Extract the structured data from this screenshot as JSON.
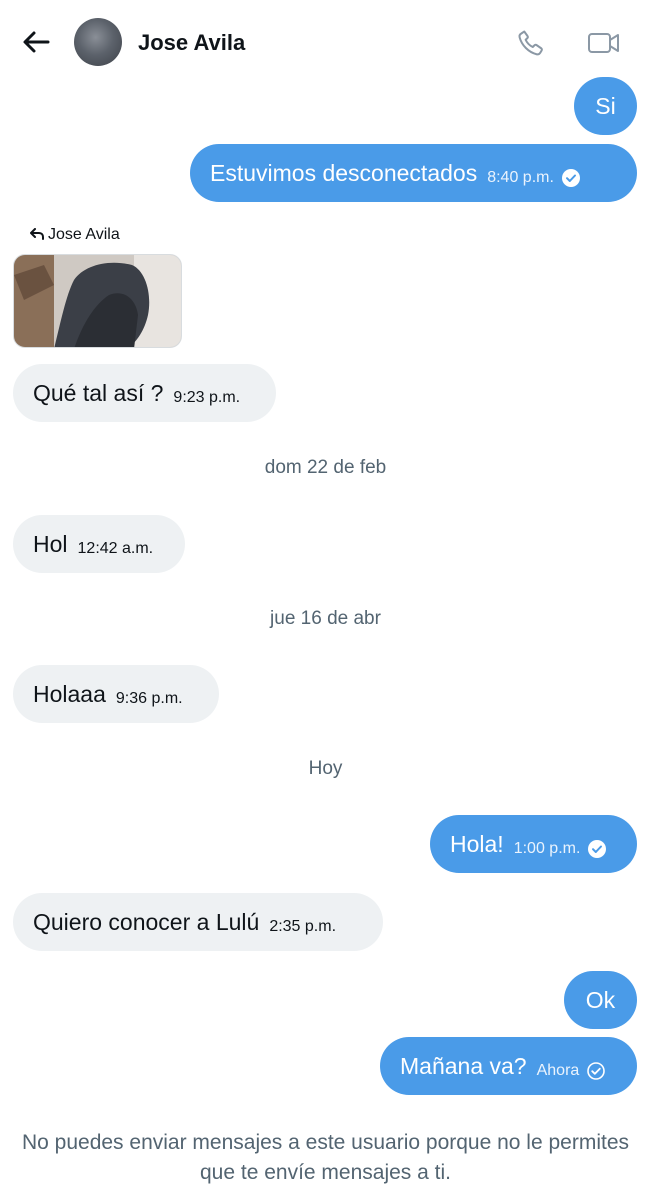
{
  "header": {
    "contact_name": "Jose Avila",
    "back_icon": "arrow-left-icon",
    "call_icon": "phone-icon",
    "video_icon": "video-camera-icon"
  },
  "messages": [
    {
      "direction": "outgoing",
      "text": "Si"
    },
    {
      "direction": "outgoing",
      "text": "Estuvimos desconectados",
      "time": "8:40 p.m.",
      "status": "read"
    },
    {
      "direction": "incoming",
      "reply_to": "Jose Avila",
      "attachment": "image"
    },
    {
      "direction": "incoming",
      "text": "Qué tal así ?",
      "time": "9:23 p.m."
    },
    {
      "direction": "incoming",
      "text": "Hol",
      "time": "12:42 a.m."
    },
    {
      "direction": "incoming",
      "text": "Holaaa",
      "time": "9:36 p.m."
    },
    {
      "direction": "outgoing",
      "text": "Hola!",
      "time": "1:00 p.m.",
      "status": "read"
    },
    {
      "direction": "incoming",
      "text": "Quiero conocer a Lulú",
      "time": "2:35 p.m."
    },
    {
      "direction": "outgoing",
      "text": "Ok"
    },
    {
      "direction": "outgoing",
      "text": "Mañana va?",
      "time": "Ahora",
      "status": "sent"
    }
  ],
  "date_separators": [
    "dom 22 de feb",
    "jue 16 de abr",
    "Hoy"
  ],
  "footer_note": "No puedes enviar mensajes a este usuario porque no le permites que te envíe mensajes a ti.",
  "colors": {
    "outgoing_bubble": "#4a9be8",
    "incoming_bubble": "#eef1f3",
    "secondary_text": "#536471"
  }
}
